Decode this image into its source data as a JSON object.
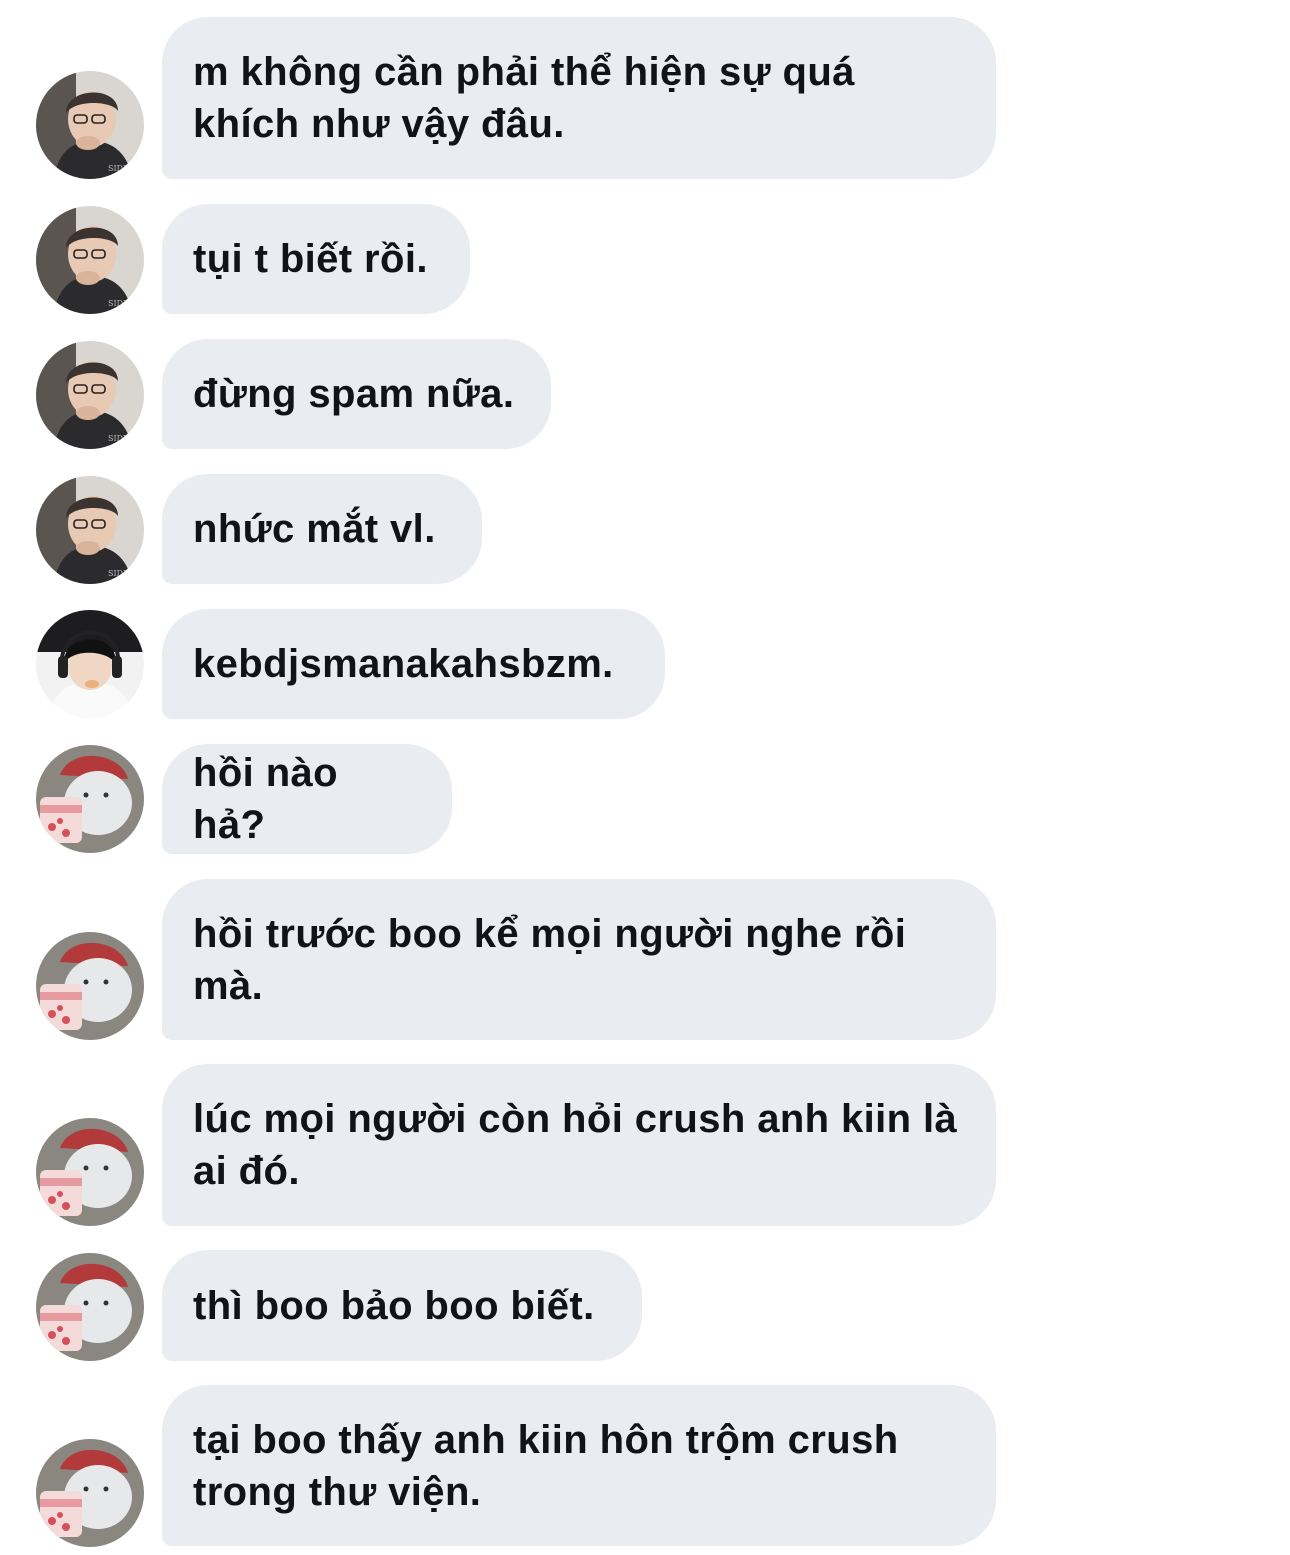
{
  "conversation": {
    "messages": [
      {
        "sender_avatar": "boy-with-glasses-avatar",
        "text": "m không cần phải thể hiện sự quá\nkhích như vậy đâu."
      },
      {
        "sender_avatar": "boy-with-glasses-avatar",
        "text": "tụi t biết rồi."
      },
      {
        "sender_avatar": "boy-with-glasses-avatar",
        "text": "đừng spam nữa."
      },
      {
        "sender_avatar": "boy-with-glasses-avatar",
        "text": "nhức mắt vl."
      },
      {
        "sender_avatar": "boy-with-headphones-avatar",
        "text": "kebdjsmanakahsbzm."
      },
      {
        "sender_avatar": "bear-with-ice-cream-avatar",
        "text": "hồi nào hả?"
      },
      {
        "sender_avatar": "bear-with-ice-cream-avatar",
        "text": "hồi trước boo kể mọi người nghe rồi\nmà."
      },
      {
        "sender_avatar": "bear-with-ice-cream-avatar",
        "text": "lúc mọi người còn hỏi crush anh kiin là\nai đó."
      },
      {
        "sender_avatar": "bear-with-ice-cream-avatar",
        "text": "thì boo bảo boo biết."
      },
      {
        "sender_avatar": "bear-with-ice-cream-avatar",
        "text": "tại boo thấy anh kiin hôn trộm crush\ntrong thư viện."
      }
    ]
  },
  "colors": {
    "bubble_background": "#e9ecf0",
    "text": "#121317",
    "page_background": "#ffffff"
  }
}
